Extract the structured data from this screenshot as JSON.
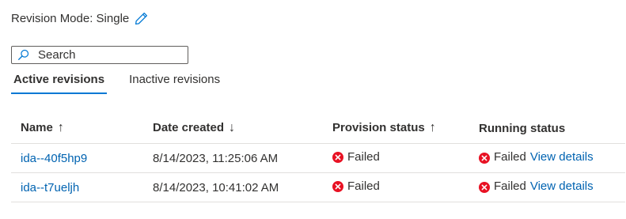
{
  "revision_mode": {
    "label": "Revision Mode: Single",
    "edit_icon": "pencil-icon"
  },
  "search": {
    "placeholder": "Search",
    "value": "",
    "icon": "search-icon"
  },
  "tabs": [
    {
      "label": "Active revisions",
      "active": true
    },
    {
      "label": "Inactive revisions",
      "active": false
    }
  ],
  "table": {
    "columns": [
      {
        "label": "Name",
        "sort": "↑"
      },
      {
        "label": "Date created",
        "sort": "↓"
      },
      {
        "label": "Provision status",
        "sort": "↑"
      },
      {
        "label": "Running status",
        "sort": ""
      }
    ],
    "rows": [
      {
        "name": "ida--40f5hp9",
        "date_created": "8/14/2023, 11:25:06 AM",
        "provision_status": "Failed",
        "running_status": "Failed",
        "details_link": "View details"
      },
      {
        "name": "ida--t7ueljh",
        "date_created": "8/14/2023, 10:41:02 AM",
        "provision_status": "Failed",
        "running_status": "Failed",
        "details_link": "View details"
      }
    ]
  },
  "colors": {
    "accent": "#0078d4",
    "link": "#0063b1",
    "error": "#e81123",
    "text": "#323130"
  }
}
